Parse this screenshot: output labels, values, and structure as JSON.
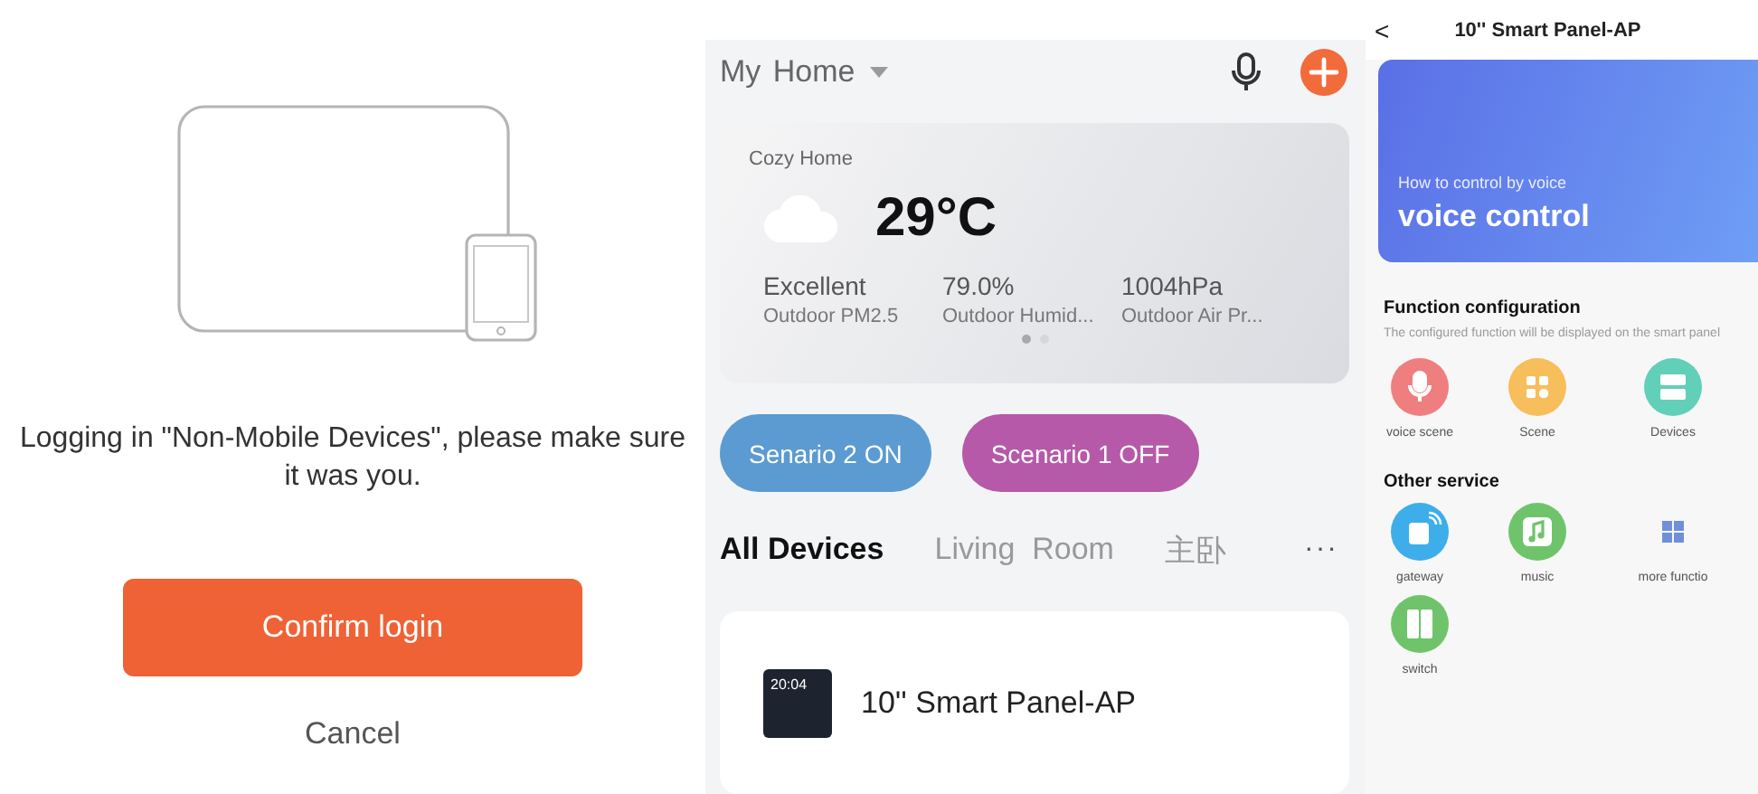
{
  "login": {
    "message": "Logging in \"Non-Mobile Devices\", please make sure it was you.",
    "confirm_button": "Confirm login",
    "cancel_button": "Cancel"
  },
  "home": {
    "title": "My Home",
    "weather": {
      "location": "Cozy Home",
      "temperature": "29°C",
      "stats": [
        {
          "value": "Excellent",
          "label": "Outdoor PM2.5"
        },
        {
          "value": "79.0%",
          "label": "Outdoor Humid..."
        },
        {
          "value": "1004hPa",
          "label": "Outdoor Air Pr..."
        }
      ],
      "pages": [
        {
          "selected": true
        },
        {
          "selected": false
        }
      ]
    },
    "scenes": [
      {
        "label": "Senario 2 ON",
        "color": "#5b9bd1"
      },
      {
        "label": "Scenario 1 OFF",
        "color": "#b659a8"
      }
    ],
    "tabs": [
      {
        "label": "All Devices",
        "selected": true
      },
      {
        "label": "Living  Room",
        "selected": false
      },
      {
        "label": "主卧",
        "selected": false
      }
    ],
    "more_tabs": "···",
    "devices": [
      {
        "name": "10'' Smart Panel-AP",
        "screen_time": "20:04"
      }
    ]
  },
  "panel": {
    "back": "<",
    "title": "10'' Smart Panel-AP",
    "banner": {
      "subtitle": "How to control by voice",
      "title": "voice control"
    },
    "sections": [
      {
        "title": "Function configuration",
        "description": "The configured function will be displayed on the smart panel",
        "items": [
          {
            "label": "voice scene",
            "kind": "mic",
            "color": "#ef7f7f"
          },
          {
            "label": "Scene",
            "kind": "grid",
            "color": "#f7be5c"
          },
          {
            "label": "Devices",
            "kind": "server",
            "color": "#62cfb8"
          }
        ]
      },
      {
        "title": "Other service",
        "items": [
          {
            "label": "gateway",
            "kind": "gateway",
            "color": "#3daee9"
          },
          {
            "label": "music",
            "kind": "music",
            "color": "#6fc46b"
          },
          {
            "label": "more functio",
            "kind": "more",
            "color": "#6f8fd8"
          },
          {
            "label": "switch",
            "kind": "switch",
            "color": "#6fc46b"
          }
        ]
      }
    ]
  }
}
